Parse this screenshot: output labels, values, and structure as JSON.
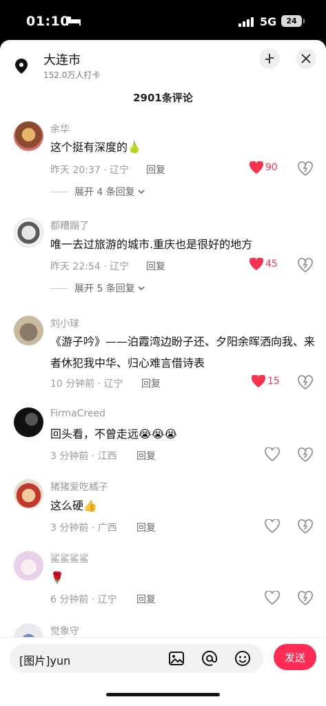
{
  "status": {
    "time": "01:10",
    "network": "5G",
    "battery": "24"
  },
  "header": {
    "location_name": "大连市",
    "checkins": "152.0万人打卡",
    "comment_count": "2901条评论"
  },
  "comments": [
    {
      "user": "余华",
      "text": "这个挺有深度的🍐",
      "meta": "昨天 20:37 · 辽宁",
      "reply": "回复",
      "likes": "90",
      "liked": true,
      "expand": "展开 4 条回复"
    },
    {
      "user": "都糟蹋了",
      "text": "唯一去过旅游的城市.重庆也是很好的地方",
      "meta": "昨天 22:54 · 辽宁",
      "reply": "回复",
      "likes": "45",
      "liked": true,
      "expand": "展开 5 条回复"
    },
    {
      "user": "刘小球",
      "text": "《游子吟》——泊霞湾边盼子还、夕阳余晖洒向我、来者休犯我中华、归心难言借诗表",
      "meta": "10 分钟前 · 辽宁",
      "reply": "回复",
      "likes": "15",
      "liked": true
    },
    {
      "user": "FirmaCreed",
      "text": "回头看，不曾走远😭😭😭",
      "meta": "3 分钟前 · 江西",
      "reply": "回复",
      "likes": "",
      "liked": false
    },
    {
      "user": "猪猪爱吃橘子",
      "text": "这么硬👍",
      "meta": "3 分钟前 · 广西",
      "reply": "回复",
      "likes": "",
      "liked": false
    },
    {
      "user": "鲨鲨鲨鲨",
      "text": "🌹",
      "meta": "6 分钟前 · 辽宁",
      "reply": "回复",
      "likes": "",
      "liked": false
    },
    {
      "user": "觉象守"
    }
  ],
  "composer": {
    "value": "[图片]yun",
    "send_label": "发送"
  },
  "colors": {
    "accent": "#fe2c55",
    "like_red": "#f5334f",
    "muted": "#999999"
  }
}
